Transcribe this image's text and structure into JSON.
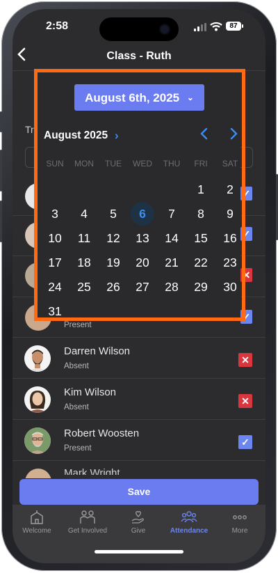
{
  "status": {
    "time": "2:58",
    "battery": "87"
  },
  "header": {
    "title": "Class - Ruth",
    "back_icon": "chevron-left-icon"
  },
  "behind": {
    "filter_partial": "Tr",
    "row4_status": "Present"
  },
  "date_picker": {
    "selected_label": "August 6th, 2025",
    "month_label": "August 2025",
    "weekdays": [
      "SUN",
      "MON",
      "TUE",
      "WED",
      "THU",
      "FRI",
      "SAT"
    ],
    "days": [
      "1",
      "2",
      "3",
      "4",
      "5",
      "6",
      "7",
      "8",
      "9",
      "10",
      "11",
      "12",
      "13",
      "14",
      "15",
      "16",
      "17",
      "18",
      "19",
      "20",
      "21",
      "22",
      "23",
      "24",
      "25",
      "26",
      "27",
      "28",
      "29",
      "30",
      "31"
    ],
    "selected_day": "6",
    "frame_color": "#ff6a13"
  },
  "members": [
    {
      "name": "Darren Wilson",
      "status": "Absent",
      "checked": false
    },
    {
      "name": "Kim Wilson",
      "status": "Absent",
      "checked": false
    },
    {
      "name": "Robert Woosten",
      "status": "Present",
      "checked": true
    }
  ],
  "partial_next_name": "Mark Wright",
  "save_label": "Save",
  "tabs": [
    {
      "label": "Welcome",
      "icon": "church-icon",
      "active": false
    },
    {
      "label": "Get Involved",
      "icon": "people-icon",
      "active": false
    },
    {
      "label": "Give",
      "icon": "hand-heart-icon",
      "active": false
    },
    {
      "label": "Attendance",
      "icon": "group-icon",
      "active": true
    },
    {
      "label": "More",
      "icon": "more-dots-icon",
      "active": false
    }
  ],
  "colors": {
    "accent": "#6b86ee",
    "primary_button": "#6b7cf0",
    "absent": "#d9363e",
    "calendar_blue": "#3b8df0"
  }
}
